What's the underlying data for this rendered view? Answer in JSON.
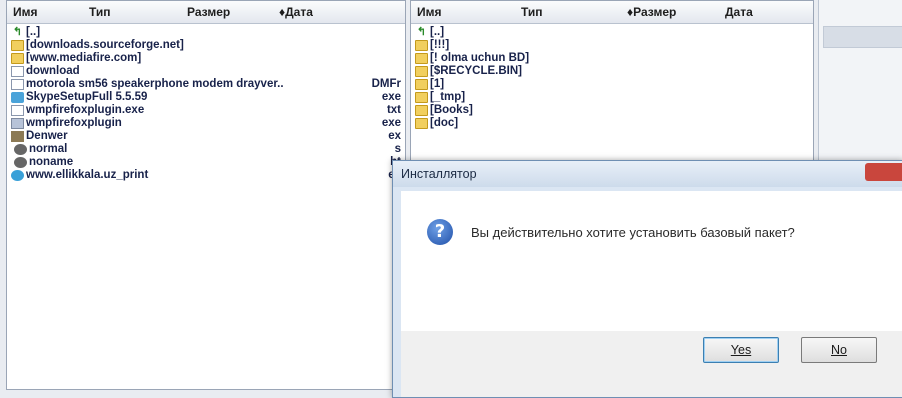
{
  "left_panel": {
    "columns": {
      "name": "Имя",
      "type": "Тип",
      "size": "Размер",
      "date": "♦Дата"
    },
    "rows": [
      {
        "icon": "up-dir-icon",
        "name": "[..]",
        "ext": ""
      },
      {
        "icon": "folder-icon",
        "name": "[downloads.sourceforge.net]",
        "ext": ""
      },
      {
        "icon": "folder-icon",
        "name": "[www.mediafire.com]",
        "ext": ""
      },
      {
        "icon": "file-icon",
        "name": "download",
        "ext": ""
      },
      {
        "icon": "file-icon",
        "name": "motorola sm56 speakerphone modem drayver..",
        "ext": "DMFr"
      },
      {
        "icon": "exe-icon",
        "name": "SkypeSetupFull 5.5.59",
        "ext": "exe"
      },
      {
        "icon": "file-icon",
        "name": "wmpfirefoxplugin.exe",
        "ext": "txt"
      },
      {
        "icon": "dll-icon",
        "name": "wmpfirefoxplugin",
        "ext": "exe"
      },
      {
        "icon": "image-icon",
        "name": "Denwer",
        "ext": "ex"
      },
      {
        "icon": "dot-icon",
        "name": "normal",
        "ext": "s"
      },
      {
        "icon": "dot-icon",
        "name": "noname",
        "ext": "ht"
      },
      {
        "icon": "web-icon",
        "name": "www.ellikkala.uz_print",
        "ext": "ex"
      }
    ]
  },
  "right_panel": {
    "columns": {
      "name": "Имя",
      "type": "Тип",
      "size": "♦Размер",
      "date": "Дата"
    },
    "rows": [
      {
        "icon": "up-dir-icon",
        "name": "[..]"
      },
      {
        "icon": "folder-icon",
        "name": "[!!!]"
      },
      {
        "icon": "folder-icon",
        "name": "[! olma uchun BD]"
      },
      {
        "icon": "folder-icon",
        "name": "[$RECYCLE.BIN]"
      },
      {
        "icon": "folder-icon",
        "name": "[1]"
      },
      {
        "icon": "folder-icon",
        "name": "[_tmp]"
      },
      {
        "icon": "folder-icon",
        "name": "[Books]"
      },
      {
        "icon": "folder-icon",
        "name": "[doc]"
      }
    ]
  },
  "dialog": {
    "title": "Инсталлятор",
    "message": "Вы действительно хотите установить базовый пакет?",
    "yes_label": "Yes",
    "no_label": "No"
  }
}
